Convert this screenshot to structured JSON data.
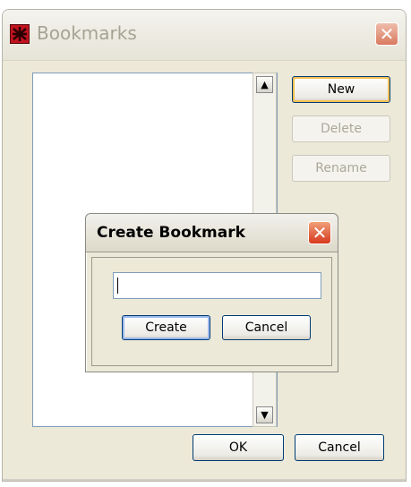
{
  "bookmarks_window": {
    "title": "Bookmarks",
    "app_icon": "bookmarks-app-icon",
    "close_icon": "close-icon",
    "scroll_up_icon": "scroll-up-arrow",
    "scroll_down_icon": "scroll-down-arrow",
    "buttons": {
      "new": "New",
      "delete": "Delete",
      "rename": "Rename",
      "ok": "OK",
      "cancel": "Cancel"
    },
    "colors": {
      "default_button_focus": "#f5c053",
      "close_active": "#d6391c",
      "close_inactive": "#d97a60"
    }
  },
  "create_dialog": {
    "title": "Create Bookmark",
    "close_icon": "close-icon",
    "input_value": "",
    "buttons": {
      "create": "Create",
      "cancel": "Cancel"
    }
  }
}
